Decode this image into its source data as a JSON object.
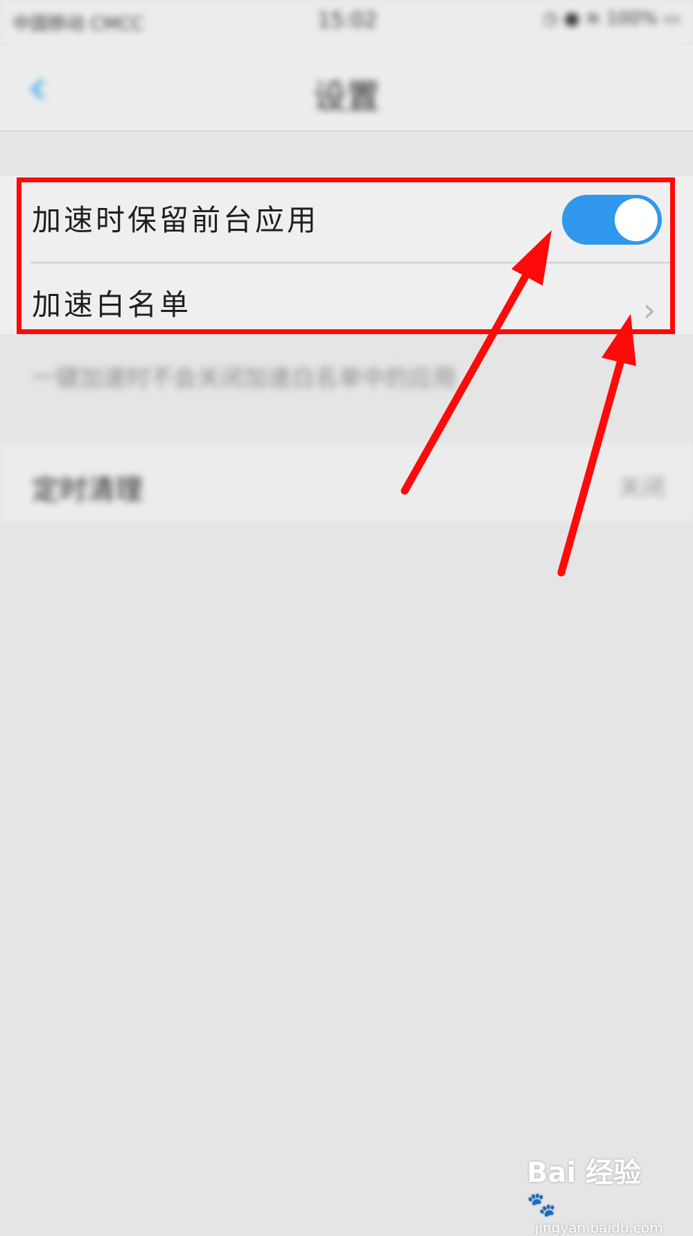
{
  "status_bar": {
    "carrier": "中国移动 CMCC",
    "time": "15:02",
    "icons": [
      "alarm-icon",
      "lock-icon",
      "wifi-icon",
      "battery-icon"
    ],
    "battery": "100%"
  },
  "nav": {
    "back_icon": "chevron-left-icon",
    "title": "设置"
  },
  "settings": {
    "keep_foreground_label": "加速时保留前台应用",
    "keep_foreground_on": true,
    "whitelist_label": "加速白名单",
    "footnote": "一键加速时不会关闭加速白名单中的应用",
    "scheduled_label": "定时清理",
    "scheduled_value": "关闭"
  },
  "annotations": {
    "highlight_color": "#ff0a0a",
    "arrow_color": "#ff0a0a"
  },
  "watermark": {
    "logo": "Bai 经验",
    "url": "jingyan.baidu.com"
  },
  "colors": {
    "accent": "#2f98ec",
    "background": "#e5e5e5"
  }
}
